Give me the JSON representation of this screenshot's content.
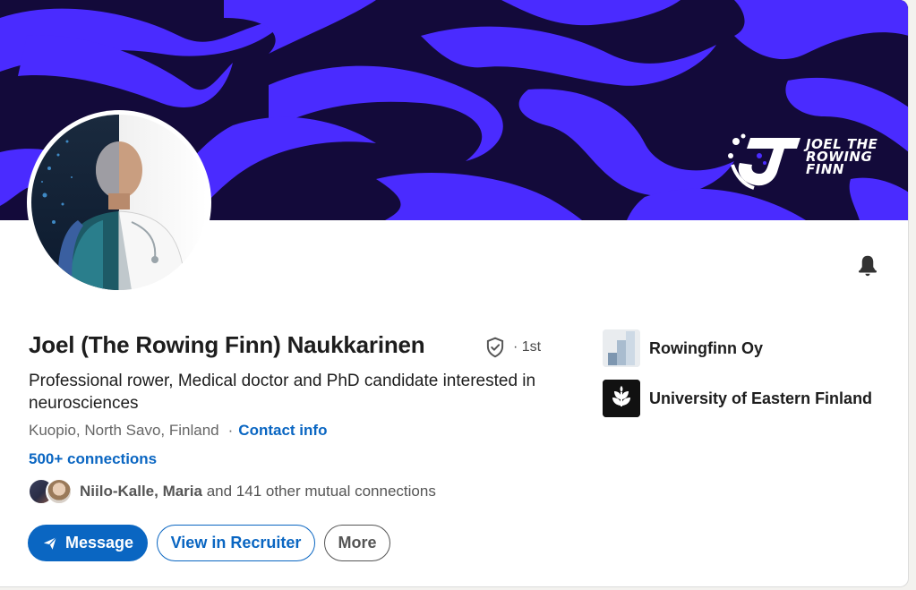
{
  "profile": {
    "name": "Joel (The Rowing Finn) Naukkarinen",
    "degree": "· 1st",
    "headline": "Professional rower, Medical doctor and PhD candidate interested in neurosciences",
    "location": "Kuopio, North Savo, Finland",
    "location_separator": "·",
    "contact_info_label": "Contact info",
    "connections_label": "500+ connections"
  },
  "banner": {
    "brand_text": "JOEL THE ROWING FINN",
    "background_color": "#130a3a",
    "accent_color": "#4a2bff"
  },
  "mutual": {
    "names": "Niilo-Kalle, Maria",
    "rest": " and 141 other mutual connections"
  },
  "actions": {
    "message_label": "Message",
    "recruiter_label": "View in Recruiter",
    "more_label": "More"
  },
  "organizations": [
    {
      "name": "Rowingfinn Oy",
      "icon": "company-logo"
    },
    {
      "name": "University of Eastern Finland",
      "icon": "university-logo"
    }
  ],
  "icons": {
    "bell": "bell-icon",
    "verified": "verified-shield-icon",
    "send": "send-icon"
  },
  "colors": {
    "link_blue": "#0a66c2",
    "text_dark": "#1d1d1d",
    "text_muted": "#666666"
  }
}
